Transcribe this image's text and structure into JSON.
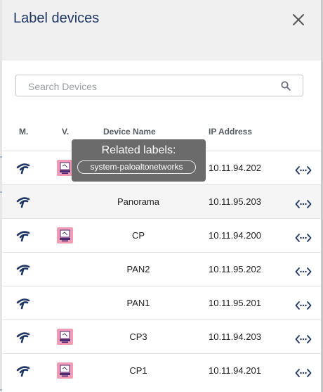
{
  "dialog": {
    "title": "Label devices"
  },
  "search": {
    "placeholder": "Search Devices"
  },
  "columns": {
    "manager": "M.",
    "vendor": "V.",
    "device_name": "Device Name",
    "ip_address": "IP Address"
  },
  "tooltip": {
    "title": "Related labels:",
    "chip": "system-paloaltonetworks"
  },
  "rows": [
    {
      "name": "",
      "ip": "10.11.94.202",
      "vendor_icon": "checkpoint-icon",
      "highlighted": false
    },
    {
      "name": "Panorama",
      "ip": "10.11.95.203",
      "vendor_icon": "",
      "highlighted": true
    },
    {
      "name": "CP",
      "ip": "10.11.94.200",
      "vendor_icon": "checkpoint-icon",
      "highlighted": false
    },
    {
      "name": "PAN2",
      "ip": "10.11.95.202",
      "vendor_icon": "",
      "highlighted": false
    },
    {
      "name": "PAN1",
      "ip": "10.11.95.201",
      "vendor_icon": "",
      "highlighted": false
    },
    {
      "name": "CP3",
      "ip": "10.11.94.203",
      "vendor_icon": "checkpoint-icon",
      "highlighted": false
    },
    {
      "name": "CP1",
      "ip": "10.11.94.201",
      "vendor_icon": "checkpoint-icon",
      "highlighted": false
    }
  ],
  "icons": {
    "manager": "paloalto-manager-icon",
    "connect": "connect-arrows-icon",
    "close": "close-icon",
    "search": "search-icon"
  },
  "colors": {
    "title": "#1e3764",
    "icon_navy": "#1e3764",
    "vendor_pink": "#f39ab4",
    "tooltip_bg": "#6b6b6b"
  }
}
